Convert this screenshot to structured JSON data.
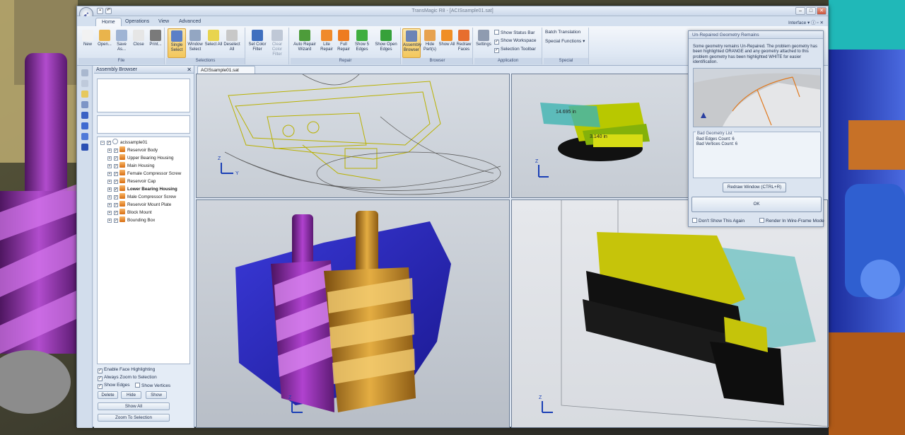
{
  "window": {
    "title": "TransMagic R8 - [ACISsample01.sat]",
    "interface_menu": "Interface"
  },
  "tabs": [
    "Home",
    "Operations",
    "View",
    "Advanced"
  ],
  "ribbon": {
    "groups": [
      "File",
      "Selections",
      "Repair",
      "Browser",
      "Application",
      "Special"
    ],
    "buttons": [
      {
        "label": "New",
        "icon": "new-file-icon",
        "color": "#f2f2f2"
      },
      {
        "label": "Open...",
        "icon": "open-folder-icon",
        "color": "#e9b44c"
      },
      {
        "label": "Save As...",
        "icon": "save-as-icon",
        "color": "#9fb4d4"
      },
      {
        "label": "Close",
        "icon": "close-file-icon",
        "color": "#e6e6e6"
      },
      {
        "label": "Print...",
        "icon": "print-icon",
        "color": "#7a7a7a"
      },
      {
        "label": "Single Select",
        "icon": "single-select-icon",
        "color": "#5b7fc7"
      },
      {
        "label": "Window Select",
        "icon": "window-select-icon",
        "color": "#93a6c2"
      },
      {
        "label": "Select All",
        "icon": "select-all-icon",
        "color": "#e8d44e"
      },
      {
        "label": "Deselect All",
        "icon": "deselect-all-icon",
        "color": "#c8c8c8"
      },
      {
        "label": "Set Color Filter",
        "icon": "color-filter-icon",
        "color": "#3f6fbf"
      },
      {
        "label": "Clear Color Filter",
        "icon": "clear-color-filter-icon",
        "color": "#bfc8d6"
      },
      {
        "label": "Auto Repair Wizard",
        "icon": "auto-repair-icon",
        "color": "#4d9c3a"
      },
      {
        "label": "Lite Repair",
        "icon": "lite-repair-icon",
        "color": "#f08a2b"
      },
      {
        "label": "Full Repair",
        "icon": "full-repair-icon",
        "color": "#ee7b1f"
      },
      {
        "label": "Show 5 Edges",
        "icon": "show-edges-icon",
        "color": "#3fae3f"
      },
      {
        "label": "Show Open Edges",
        "icon": "show-open-edges-icon",
        "color": "#36a13a"
      },
      {
        "label": "Assembly Browser",
        "icon": "assembly-browser-icon",
        "color": "#6c84b6"
      },
      {
        "label": "Hide Part(s)",
        "icon": "hide-parts-icon",
        "color": "#e7a24e"
      },
      {
        "label": "Show All",
        "icon": "show-all-icon",
        "color": "#f08e25"
      },
      {
        "label": "Redraw Faces",
        "icon": "redraw-faces-icon",
        "color": "#e76e2e"
      },
      {
        "label": "Settings",
        "icon": "gear-icon",
        "color": "#8f9bb0"
      }
    ],
    "app_checks": [
      {
        "label": "Show Status Bar",
        "checked": false
      },
      {
        "label": "Show Workspace",
        "checked": true
      },
      {
        "label": "Selection Toolbar",
        "checked": true
      }
    ],
    "special": {
      "batch": "Batch Translation",
      "functions": "Special Functions"
    }
  },
  "assembly_browser": {
    "title": "Assembly Browser",
    "root": "acissample01",
    "parts": [
      "Reservoir Body",
      "Upper Bearing Housing",
      "Main Housing",
      "Female Compressor Screw",
      "Reservoir Cap",
      "Lower Bearing Housing",
      "Male Compressor Screw",
      "Reservoir Mount Plate",
      "Block Mount",
      "Bounding Box"
    ],
    "bold_part": "Lower Bearing Housing",
    "options": [
      {
        "label": "Enable Face Highlighting",
        "checked": true
      },
      {
        "label": "Always Zoom to Selection",
        "checked": true
      },
      {
        "label": "Show Edges",
        "checked": true
      },
      {
        "label": "Show Vertices",
        "checked": false
      }
    ],
    "buttons": {
      "delete": "Delete",
      "hide": "Hide",
      "show": "Show",
      "show_all": "Show All",
      "zoom": "Zoom To Selection"
    }
  },
  "document_tab": "ACISsample01.sat",
  "viewport_tr": {
    "dim1": "14.695 in",
    "dim2": "3.140 in"
  },
  "axis": {
    "z": "Z",
    "y": "Y"
  },
  "dialog": {
    "title": "Un-Repaired Geometry Remains",
    "message": "Some geometry remains Un-Repaired. The problem geometry has been highlighted ORANGE and any geometry attached to this problem geometry has been highlighted WHITE for easier identification.",
    "list_title": "Bad Geometry List",
    "list": [
      "Bad Edges Count: 6",
      "Bad Vertices Count: 6"
    ],
    "redraw": "Redraw Window (CTRL+R)",
    "ok": "OK",
    "dont_show": "Don't Show This Again",
    "wireframe": "Render In Wire-Frame Mode"
  },
  "colors": {
    "ribbon_bg": "#dfe8f4",
    "dialog_bg": "#dbe4f0",
    "purple_screw": "#8a2fa6",
    "gold_screw": "#c8902a",
    "blue_housing": "#2c2bc2",
    "teal_box": "#4dc7c0"
  }
}
